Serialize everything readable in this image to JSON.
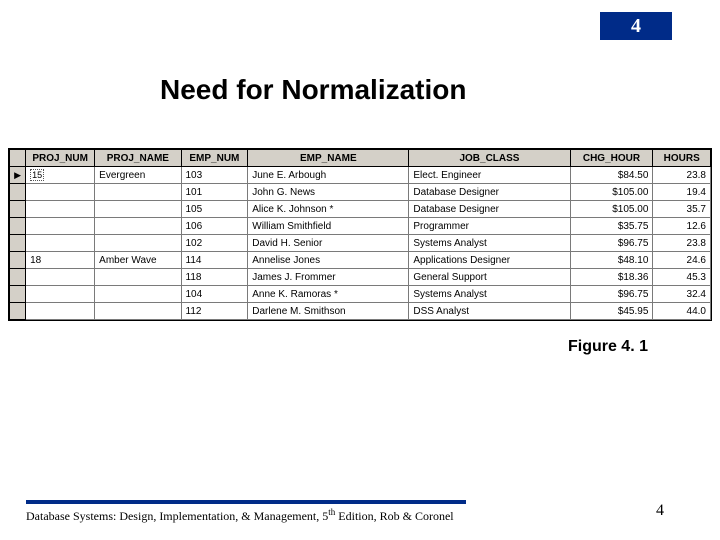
{
  "chapter_badge": "4",
  "title": "Need for Normalization",
  "caption": "Figure 4. 1",
  "footer": {
    "text_a": "Database Systems: Design, Implementation, & Management, 5",
    "sup": "th",
    "text_b": " Edition, Rob & Coronel"
  },
  "page_number": "4",
  "table": {
    "headers": [
      "PROJ_NUM",
      "PROJ_NAME",
      "EMP_NUM",
      "EMP_NAME",
      "JOB_CLASS",
      "CHG_HOUR",
      "HOURS"
    ],
    "rows": [
      {
        "indicator": "▶",
        "proj_num": "15",
        "proj_name": "Evergreen",
        "emp_num": "103",
        "emp_name": "June E. Arbough",
        "job_class": "Elect. Engineer",
        "chg_hour": "$84.50",
        "hours": "23.8"
      },
      {
        "indicator": "",
        "proj_num": "",
        "proj_name": "",
        "emp_num": "101",
        "emp_name": "John G. News",
        "job_class": "Database Designer",
        "chg_hour": "$105.00",
        "hours": "19.4"
      },
      {
        "indicator": "",
        "proj_num": "",
        "proj_name": "",
        "emp_num": "105",
        "emp_name": "Alice K. Johnson *",
        "job_class": "Database Designer",
        "chg_hour": "$105.00",
        "hours": "35.7"
      },
      {
        "indicator": "",
        "proj_num": "",
        "proj_name": "",
        "emp_num": "106",
        "emp_name": "William Smithfield",
        "job_class": "Programmer",
        "chg_hour": "$35.75",
        "hours": "12.6"
      },
      {
        "indicator": "",
        "proj_num": "",
        "proj_name": "",
        "emp_num": "102",
        "emp_name": "David H. Senior",
        "job_class": "Systems Analyst",
        "chg_hour": "$96.75",
        "hours": "23.8"
      },
      {
        "indicator": "",
        "proj_num": "18",
        "proj_name": "Amber Wave",
        "emp_num": "114",
        "emp_name": "Annelise Jones",
        "job_class": "Applications Designer",
        "chg_hour": "$48.10",
        "hours": "24.6"
      },
      {
        "indicator": "",
        "proj_num": "",
        "proj_name": "",
        "emp_num": "118",
        "emp_name": "James J. Frommer",
        "job_class": "General Support",
        "chg_hour": "$18.36",
        "hours": "45.3"
      },
      {
        "indicator": "",
        "proj_num": "",
        "proj_name": "",
        "emp_num": "104",
        "emp_name": "Anne K. Ramoras *",
        "job_class": "Systems Analyst",
        "chg_hour": "$96.75",
        "hours": "32.4"
      },
      {
        "indicator": "",
        "proj_num": "",
        "proj_name": "",
        "emp_num": "112",
        "emp_name": "Darlene M. Smithson",
        "job_class": "DSS Analyst",
        "chg_hour": "$45.95",
        "hours": "44.0"
      }
    ]
  }
}
